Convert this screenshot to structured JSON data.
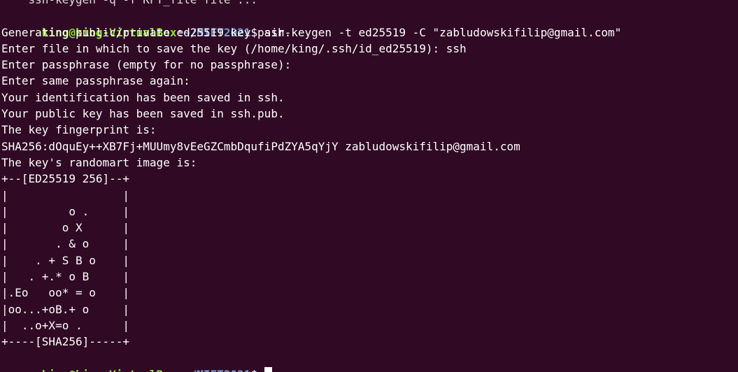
{
  "partial_top_line": "    ssh-keygen -q -f KFT_file file ...",
  "prompt": {
    "user_host": "king@king-VirtualBox",
    "separator": ":",
    "path": "~/MIFT2021",
    "symbol": "$ "
  },
  "command": "ssh-keygen -t ed25519 -C \"zabludowskifilip@gmail.com\"",
  "output_lines": [
    "Generating public/private ed25519 key pair.",
    "Enter file in which to save the key (/home/king/.ssh/id_ed25519): ssh",
    "Enter passphrase (empty for no passphrase):",
    "Enter same passphrase again:",
    "Your identification has been saved in ssh.",
    "Your public key has been saved in ssh.pub.",
    "The key fingerprint is:",
    "SHA256:dOquEy++XB7Fj+MUUmy8vEeGZCmbDqufiPdZYA5qYjY zabludowskifilip@gmail.com",
    "The key's randomart image is:",
    "+--[ED25519 256]--+",
    "|                 |",
    "|         o .     |",
    "|        o X      |",
    "|       . & o     |",
    "|    . + S B o    |",
    "|   . +.* o B     |",
    "|.Eo   oo* = o    |",
    "|oo...+oB.+ o     |",
    "|  ..o+X=o .      |",
    "+----[SHA256]-----+"
  ]
}
